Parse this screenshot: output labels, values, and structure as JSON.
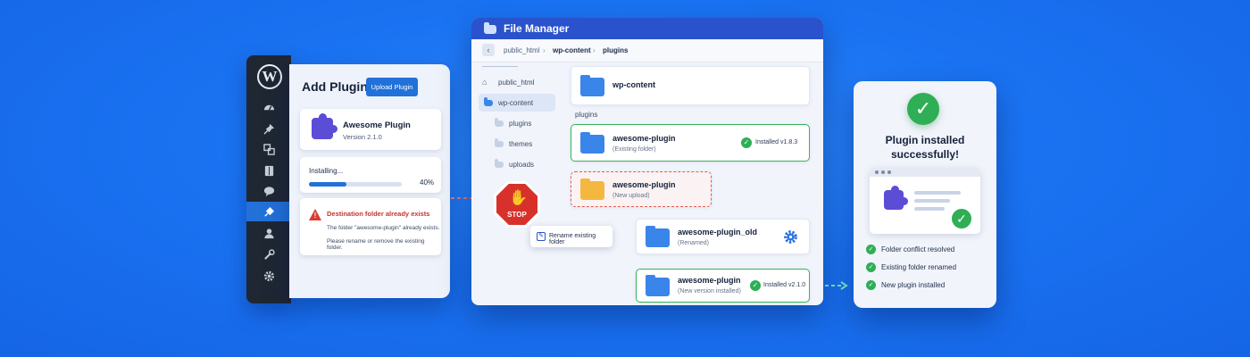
{
  "wordpress": {
    "logo": "W",
    "nav_icons": [
      "dashboard-icon",
      "pin-icon",
      "media-icon",
      "pages-icon",
      "comments-icon",
      "plugins-icon",
      "users-icon",
      "tools-icon",
      "settings-icon"
    ],
    "page_title": "Add Plugins",
    "upload_button": "Upload Plugin",
    "plugin_card": {
      "name": "Awesome Plugin",
      "version": "Version 2.1.0"
    },
    "install_status": {
      "label": "Installing...",
      "percent_text": "40%",
      "progress": 0.4
    },
    "error": {
      "title": "Destination folder already exists",
      "line1": "The folder \"awesome-plugin\" already exists.",
      "line2": "Please rename or remove the existing folder."
    }
  },
  "stop_sign": {
    "label": "STOP"
  },
  "file_manager": {
    "title": "File Manager",
    "breadcrumb": [
      "public_html",
      "wp-content",
      "plugins"
    ],
    "sidebar": [
      {
        "label": "public_html"
      },
      {
        "label": "wp-content"
      },
      {
        "label": "plugins"
      },
      {
        "label": "themes"
      },
      {
        "label": "uploads"
      }
    ],
    "top_folder": "wp-content",
    "section_label": "plugins",
    "rows": {
      "existing": {
        "name": "awesome-plugin",
        "sub": "(Existing folder)",
        "status": "Installed v1.8.3"
      },
      "upload": {
        "name": "awesome-plugin",
        "sub": "(New upload)"
      },
      "renamed": {
        "name": "awesome-plugin_old",
        "sub": "(Renamed)"
      },
      "new_version": {
        "name": "awesome-plugin",
        "sub": "(New version installed)",
        "status": "Installed v2.1.0"
      }
    },
    "rename_action": "Rename existing folder"
  },
  "success": {
    "title_line1": "Plugin installed",
    "title_line2": "successfully!",
    "items": [
      "Folder conflict resolved",
      "Existing folder renamed",
      "New plugin installed"
    ]
  },
  "colors": {
    "background": "#1a73f2",
    "accent": "#2271d9",
    "success": "#2fae56",
    "error": "#d93a32"
  }
}
